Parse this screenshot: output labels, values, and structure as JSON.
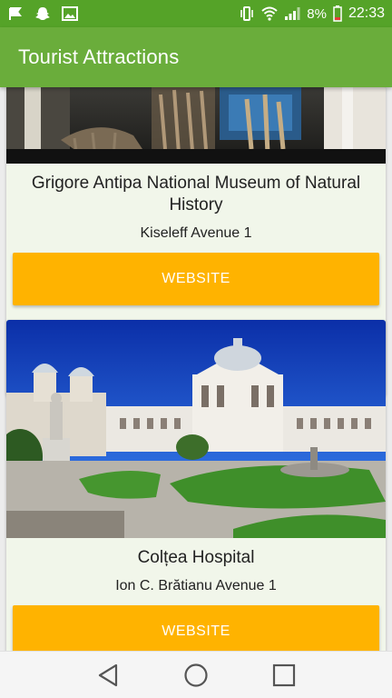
{
  "status_bar": {
    "battery": "8%",
    "time": "22:33",
    "icons": [
      "notification-flag-icon",
      "snapchat-icon",
      "gallery-icon",
      "vibrate-icon",
      "wifi-icon",
      "signal-icon",
      "battery-low-icon"
    ]
  },
  "app_bar": {
    "title": "Tourist Attractions"
  },
  "attractions": [
    {
      "name": "Grigore Antipa National Museum of Natural History",
      "address": "Kiseleff Avenue 1",
      "button_label": "WEBSITE"
    },
    {
      "name": "Colțea Hospital",
      "address": "Ion C. Brătianu Avenue 1",
      "button_label": "WEBSITE"
    }
  ],
  "nav_bar": {
    "buttons": [
      "back-icon",
      "home-icon",
      "recents-icon"
    ]
  },
  "colors": {
    "status_bar": "#55a328",
    "app_bar": "#6aad3b",
    "button": "#ffb300",
    "card": "#f1f6ea"
  }
}
